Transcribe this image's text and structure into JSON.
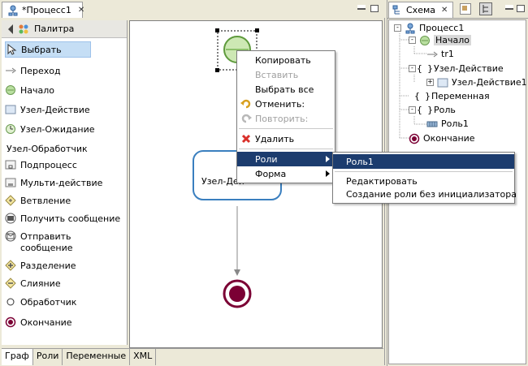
{
  "editor": {
    "tab_title": "*Процесс1"
  },
  "palette": {
    "header": "Палитра",
    "items": [
      "Выбрать",
      "Переход",
      "Начало",
      "Узел-Действие",
      "Узел-Ожидание",
      "Узел-Обработчик",
      "Подпроцесс",
      "Мульти-действие",
      "Ветвление",
      "Получить сообщение",
      "Отправить",
      "сообщение",
      "Разделение",
      "Слияние",
      "Обработчик",
      "Окончание"
    ]
  },
  "canvas": {
    "node_action_label": "Узел-Дей"
  },
  "bottom_tabs": [
    "Граф",
    "Роли",
    "Переменные",
    "XML"
  ],
  "context_menu": {
    "items": [
      {
        "label": "Копировать",
        "enabled": true
      },
      {
        "label": "Вставить",
        "enabled": false
      },
      {
        "label": "Выбрать все",
        "enabled": true
      },
      {
        "label": "Отменить:",
        "enabled": true,
        "icon": "undo-icon"
      },
      {
        "label": "Повторить:",
        "enabled": false,
        "icon": "redo-icon"
      },
      {
        "label": "Удалить",
        "enabled": true,
        "icon": "delete-icon"
      },
      {
        "label": "Роли",
        "enabled": true,
        "submenu": true,
        "highlighted": true
      },
      {
        "label": "Форма",
        "enabled": true,
        "submenu": true
      }
    ]
  },
  "submenu": {
    "items": [
      {
        "label": "Роль1",
        "highlighted": true
      },
      {
        "label": "Редактировать"
      },
      {
        "label": "Создание роли без инициализатора"
      }
    ]
  },
  "outline": {
    "tab_title": "Схема",
    "tree": [
      {
        "label": "Процесс1"
      },
      {
        "label": "Начало"
      },
      {
        "label": "tr1"
      },
      {
        "label": "Узел-Действие"
      },
      {
        "label": "Узел-Действие1"
      },
      {
        "label": "Переменная"
      },
      {
        "label": "Роль"
      },
      {
        "label": "Роль1"
      },
      {
        "label": "Окончание"
      }
    ]
  },
  "colors": {
    "accent_blue": "#1c3c6e",
    "node_border": "#3a7fbf",
    "end_node": "#7b0034",
    "start_node": "#6db33f"
  }
}
